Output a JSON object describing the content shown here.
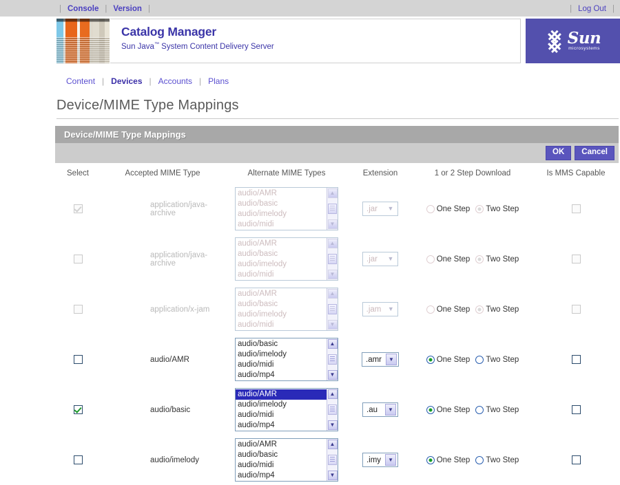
{
  "topbar": {
    "left_links": [
      {
        "label": "Console",
        "bold": true
      },
      {
        "label": "Version",
        "bold": true
      }
    ],
    "logout_label": "Log Out"
  },
  "masthead": {
    "title": "Catalog Manager",
    "subtitle_pre": "Sun Java",
    "subtitle_tm": "™",
    "subtitle_post": " System Content Delivery Server",
    "logo_name": "Sun",
    "logo_tagline": "microsystems",
    "logo_bg": "#5350ad"
  },
  "subnav": {
    "items": [
      {
        "label": "Content",
        "active": false
      },
      {
        "label": "Devices",
        "active": true
      },
      {
        "label": "Accounts",
        "active": false
      },
      {
        "label": "Plans",
        "active": false
      }
    ]
  },
  "page": {
    "title": "Device/MIME Type Mappings",
    "section_label": "Device/MIME Type Mappings",
    "ok_label": "OK",
    "cancel_label": "Cancel",
    "accent_button": "#5a55bd",
    "section_bar_bg": "#a8a8a8"
  },
  "table": {
    "headers": [
      "Select",
      "Accepted MIME Type",
      "Alternate MIME Types",
      "Extension",
      "1 or 2 Step Download",
      "Is MMS Capable"
    ],
    "step_labels": {
      "one": "One Step",
      "two": "Two Step"
    },
    "rows": [
      {
        "selected": true,
        "disabled": true,
        "mime": "application/java-archive",
        "alternates": [
          "audio/AMR",
          "audio/basic",
          "audio/imelody",
          "audio/midi"
        ],
        "alt_selected_index": -1,
        "extension": ".jar",
        "step": "two",
        "mms": false
      },
      {
        "selected": false,
        "disabled": true,
        "mime": "application/java-archive",
        "alternates": [
          "audio/AMR",
          "audio/basic",
          "audio/imelody",
          "audio/midi"
        ],
        "alt_selected_index": -1,
        "extension": ".jar",
        "step": "two",
        "mms": false
      },
      {
        "selected": false,
        "disabled": true,
        "mime": "application/x-jam",
        "alternates": [
          "audio/AMR",
          "audio/basic",
          "audio/imelody",
          "audio/midi"
        ],
        "alt_selected_index": -1,
        "extension": ".jam",
        "step": "two",
        "mms": false
      },
      {
        "selected": false,
        "disabled": false,
        "mime": "audio/AMR",
        "alternates": [
          "audio/basic",
          "audio/imelody",
          "audio/midi",
          "audio/mp4"
        ],
        "alt_selected_index": -1,
        "extension": ".amr",
        "step": "one",
        "mms": false
      },
      {
        "selected": true,
        "disabled": false,
        "mime": "audio/basic",
        "alternates": [
          "audio/AMR",
          "audio/imelody",
          "audio/midi",
          "audio/mp4"
        ],
        "alt_selected_index": 0,
        "extension": ".au",
        "step": "one",
        "mms": false
      },
      {
        "selected": false,
        "disabled": false,
        "mime": "audio/imelody",
        "alternates": [
          "audio/AMR",
          "audio/basic",
          "audio/midi",
          "audio/mp4"
        ],
        "alt_selected_index": -1,
        "extension": ".imy",
        "step": "one",
        "mms": false
      }
    ]
  }
}
